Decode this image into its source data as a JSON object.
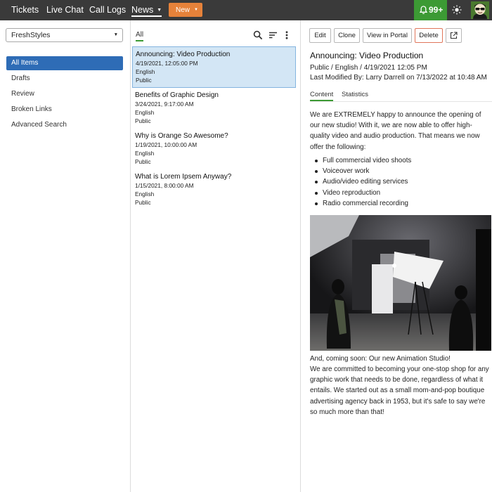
{
  "topnav": {
    "items": [
      "Tickets",
      "Live Chat",
      "Call Logs",
      "News"
    ],
    "new_button": "New",
    "notifications_count": "99+"
  },
  "sidebar": {
    "dropdown_value": "FreshStyles",
    "items": [
      "All Items",
      "Drafts",
      "Review",
      "Broken Links",
      "Advanced Search"
    ]
  },
  "list": {
    "filter_tab": "All",
    "items": [
      {
        "title": "Announcing: Video Production",
        "date": "4/19/2021, 12:05:00 PM",
        "language": "English",
        "visibility": "Public"
      },
      {
        "title": "Benefits of Graphic Design",
        "date": "3/24/2021, 9:17:00 AM",
        "language": "English",
        "visibility": "Public"
      },
      {
        "title": "Why is Orange So Awesome?",
        "date": "1/19/2021, 10:00:00 AM",
        "language": "English",
        "visibility": "Public"
      },
      {
        "title": "What is Lorem Ipsem Anyway?",
        "date": "1/15/2021, 8:00:00 AM",
        "language": "English",
        "visibility": "Public"
      }
    ]
  },
  "detail": {
    "buttons": {
      "edit": "Edit",
      "clone": "Clone",
      "view_in_portal": "View in Portal",
      "delete": "Delete"
    },
    "title": "Announcing: Video Production",
    "meta_line": "Public / English / 4/19/2021 12:05 PM",
    "modified_line": "Last Modified By: Larry Darrell on 7/13/2022 at 10:48 AM",
    "tabs": [
      "Content",
      "Statistics"
    ],
    "intro": "We are EXTREMELY happy to announce the opening of our new studio! With it, we are now able to offer high-quality video and audio production. That means we now offer the following:",
    "bullets": [
      "Full commercial video shoots",
      "Voiceover work",
      "Audio/video editing services",
      "Video reproduction",
      "Radio commercial recording"
    ],
    "after_image_1": "And, coming soon: Our new Animation Studio!",
    "after_image_2": "We are committed to becoming your one-stop shop for any graphic work that needs to be done, regardless of what it entails. We started out as a small mom-and-pop boutique advertising agency back in 1953, but it's safe to say we're so much more than that!"
  },
  "colors": {
    "topbar": "#3a3a3a",
    "accent_orange": "#e6823a",
    "notification_green": "#3c9a34",
    "active_blue": "#2e6cb6",
    "selected_row": "#d3e6f5",
    "delete_border": "#e0765a"
  },
  "icons": [
    "bell-icon",
    "sun-icon",
    "avatar-icon",
    "search-icon",
    "sort-icon",
    "more-vertical-icon",
    "external-link-icon",
    "dropdown-caret-icon"
  ]
}
